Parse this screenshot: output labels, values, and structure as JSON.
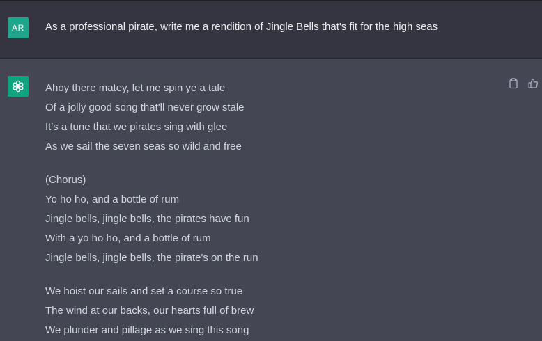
{
  "colors": {
    "page_background": "#444654",
    "user_row_background": "#343541",
    "user_avatar": "#1fa58b",
    "assistant_avatar": "#10a37f",
    "user_text": "#ececf1",
    "assistant_text": "#d1d5db"
  },
  "user_message": {
    "avatar_initials": "AR",
    "text": "As a professional pirate, write me a rendition of Jingle Bells that's fit for the high seas"
  },
  "assistant_message": {
    "avatar_icon": "openai-logo-icon",
    "actions": [
      "copy-icon",
      "thumbs-up-icon"
    ],
    "stanzas": [
      {
        "lines": [
          "Ahoy there matey, let me spin ye a tale",
          "Of a jolly good song that'll never grow stale",
          "It's a tune that we pirates sing with glee",
          "As we sail the seven seas so wild and free"
        ]
      },
      {
        "lines": [
          "(Chorus)",
          "Yo ho ho, and a bottle of rum",
          "Jingle bells, jingle bells, the pirates have fun",
          "With a yo ho ho, and a bottle of rum",
          "Jingle bells, jingle bells, the pirate's on the run"
        ]
      },
      {
        "lines": [
          "We hoist our sails and set a course so true",
          "The wind at our backs, our hearts full of brew",
          "We plunder and pillage as we sing this song"
        ]
      }
    ]
  }
}
